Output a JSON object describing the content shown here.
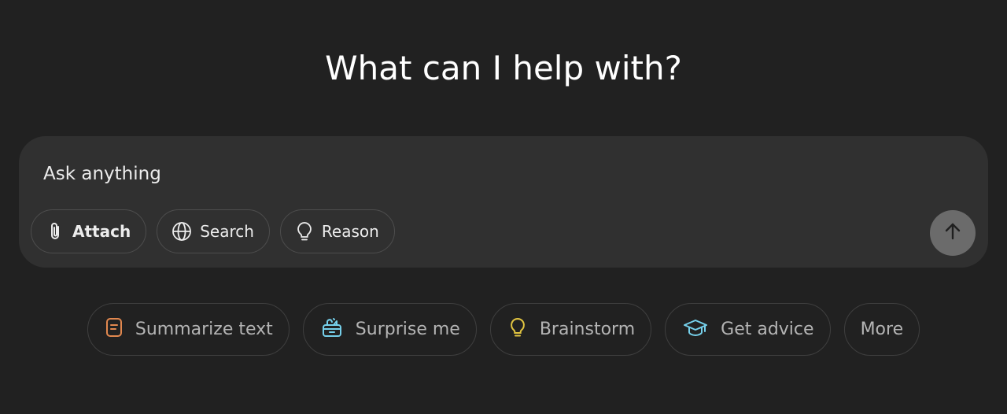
{
  "main": {
    "headline": "What can I help with?"
  },
  "composer": {
    "placeholder": "Ask anything",
    "tools": [
      {
        "label": "Attach",
        "icon": "paperclip-icon"
      },
      {
        "label": "Search",
        "icon": "globe-icon"
      },
      {
        "label": "Reason",
        "icon": "lightbulb-icon"
      }
    ],
    "send_icon": "arrow-up-icon"
  },
  "suggestions": [
    {
      "label": "Summarize text",
      "icon": "document-icon",
      "color": "#e2884f"
    },
    {
      "label": "Surprise me",
      "icon": "gift-icon",
      "color": "#76d0eb"
    },
    {
      "label": "Brainstorm",
      "icon": "lightbulb-icon",
      "color": "#e2c541"
    },
    {
      "label": "Get advice",
      "icon": "graduation-cap-icon",
      "color": "#76d0eb"
    },
    {
      "label": "More",
      "icon": ""
    }
  ],
  "colors": {
    "background": "#212121",
    "composer": "#303030",
    "send_button": "#6b6b6b"
  }
}
